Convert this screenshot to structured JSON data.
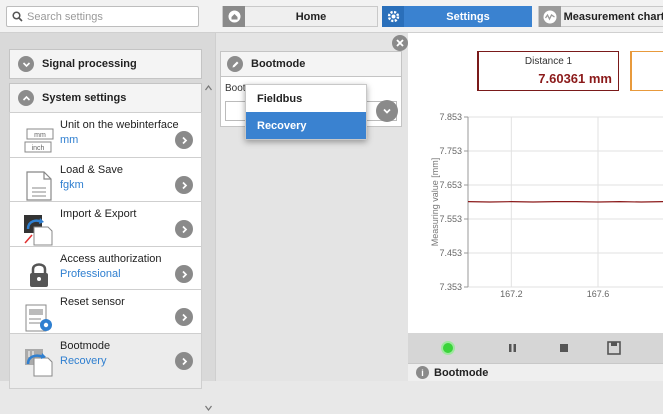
{
  "search": {
    "placeholder": "Search settings"
  },
  "nav": {
    "home": "Home",
    "settings": "Settings",
    "measurement": "Measurement chart"
  },
  "sections": {
    "signal_processing": "Signal processing",
    "system_settings": "System settings"
  },
  "items": [
    {
      "title": "Unit on the webinterface",
      "value": "mm",
      "icon": "unit-icon",
      "icon_labels": [
        "mm",
        "inch"
      ]
    },
    {
      "title": "Load & Save",
      "value": "fgkm",
      "icon": "document-icon"
    },
    {
      "title": "Import & Export",
      "icon": "import-export-icon"
    },
    {
      "title": "Access authorization",
      "value": "Professional",
      "icon": "lock-icon"
    },
    {
      "title": "Reset sensor",
      "icon": "reset-sensor-icon"
    },
    {
      "title": "Bootmode",
      "value": "Recovery",
      "icon": "bootmode-icon"
    }
  ],
  "bootmode_panel": {
    "title": "Bootmode",
    "label": "Bootm"
  },
  "dropdown": {
    "options": [
      "Fieldbus",
      "Recovery"
    ],
    "selected": "Recovery"
  },
  "distance": {
    "label": "Distance 1",
    "value": "7.60361 mm"
  },
  "chart_data": {
    "type": "line",
    "ylabel": "Measuring value [mm]",
    "yticks": [
      "7.853",
      "7.753",
      "7.653",
      "7.553",
      "7.453",
      "7.353"
    ],
    "xticks": [
      "167.2",
      "167.6"
    ],
    "ylim": [
      7.353,
      7.853
    ],
    "xlim": [
      167.0,
      167.9
    ],
    "grid": true,
    "series": [
      {
        "values": [
          7.604,
          7.603,
          7.604,
          7.603,
          7.604,
          7.604,
          7.603,
          7.604,
          7.603,
          7.604
        ]
      }
    ],
    "color": "#8b1a1a"
  },
  "footer": {
    "title": "Bootmode"
  },
  "colors": {
    "accent": "#3a82d0",
    "value_text": "#2f7fd0",
    "distance": "#8b1a1a"
  }
}
